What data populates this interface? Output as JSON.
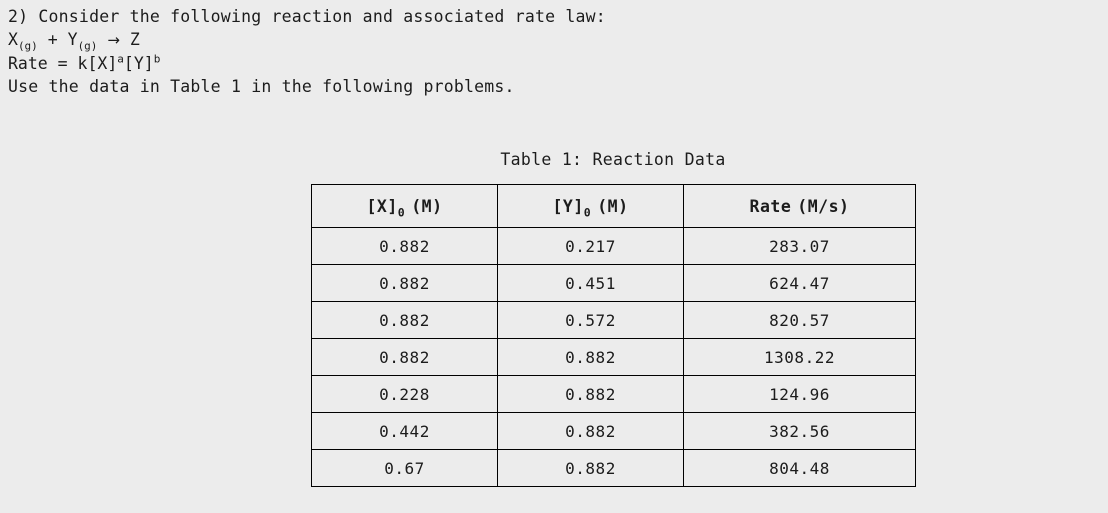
{
  "problem": {
    "number_prefix": "2)",
    "statement": "2) Consider the following reaction and associated rate law:",
    "reaction": {
      "reactant_x": "X",
      "reactant_x_state": "(g)",
      "plus": "+",
      "reactant_y": "Y",
      "reactant_y_state": "(g)",
      "arrow": "→",
      "product": "Z"
    },
    "rate_law": {
      "lhs": "Rate = k[X]",
      "exp_a": "a",
      "mid": "[Y]",
      "exp_b": "b"
    },
    "instruction": "Use the data in Table 1 in the following problems."
  },
  "table": {
    "caption": "Table 1: Reaction Data",
    "headers": [
      {
        "base": "[X]",
        "sub": "0",
        "unit": "(M)"
      },
      {
        "base": "[Y]",
        "sub": "0",
        "unit": "(M)"
      },
      {
        "base": "Rate",
        "sub": "",
        "unit": "(M/s)"
      }
    ],
    "rows": [
      [
        "0.882",
        "0.217",
        "283.07"
      ],
      [
        "0.882",
        "0.451",
        "624.47"
      ],
      [
        "0.882",
        "0.572",
        "820.57"
      ],
      [
        "0.882",
        "0.882",
        "1308.22"
      ],
      [
        "0.228",
        "0.882",
        "124.96"
      ],
      [
        "0.442",
        "0.882",
        "382.56"
      ],
      [
        "0.67",
        "0.882",
        "804.48"
      ]
    ]
  },
  "colors": {
    "page_background": "#ececec",
    "text": "#1c1c1c",
    "table_border": "#000000"
  }
}
